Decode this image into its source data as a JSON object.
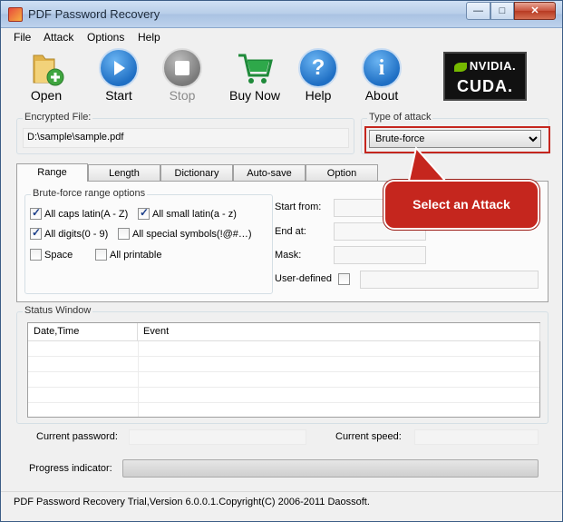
{
  "window": {
    "title": "PDF Password Recovery"
  },
  "caption_buttons": {
    "minimize": "—",
    "maximize": "□",
    "close": "✕"
  },
  "menu": [
    "File",
    "Attack",
    "Options",
    "Help"
  ],
  "toolbar": {
    "open": "Open",
    "start": "Start",
    "stop": "Stop",
    "buy": "Buy Now",
    "help": "Help",
    "about": "About",
    "nvidia_brand": "NVIDIA.",
    "cuda_brand": "CUDA."
  },
  "encrypted_file": {
    "label": "Encrypted File:",
    "value": "D:\\sample\\sample.pdf"
  },
  "attack": {
    "label": "Type of attack",
    "selected": "Brute-force"
  },
  "callout": "Select an Attack",
  "tabs": [
    "Range",
    "Length",
    "Dictionary",
    "Auto-save",
    "Option"
  ],
  "range": {
    "group_title": "Brute-force range options",
    "caps": {
      "label": "All caps latin(A - Z)",
      "checked": true
    },
    "small": {
      "label": "All small latin(a - z)",
      "checked": true
    },
    "digits": {
      "label": "All digits(0 - 9)",
      "checked": true
    },
    "special": {
      "label": "All special symbols(!@#…)",
      "checked": false
    },
    "space": {
      "label": "Space",
      "checked": false
    },
    "printable": {
      "label": "All printable",
      "checked": false
    },
    "start_from": "Start from:",
    "end_at": "End at:",
    "mask": "Mask:",
    "user_defined": "User-defined"
  },
  "status_window": {
    "title": "Status Window",
    "columns": [
      "Date,Time",
      "Event"
    ]
  },
  "current_password_label": "Current password:",
  "current_speed_label": "Current speed:",
  "progress_label": "Progress indicator:",
  "progress": 0,
  "status_bar": "PDF Password Recovery Trial,Version 6.0.0.1.Copyright(C) 2006-2011 Daossoft.",
  "colors": {
    "callout": "#c5261e",
    "play_blue": "#1f6fc4",
    "nvidia_green": "#76b900"
  }
}
